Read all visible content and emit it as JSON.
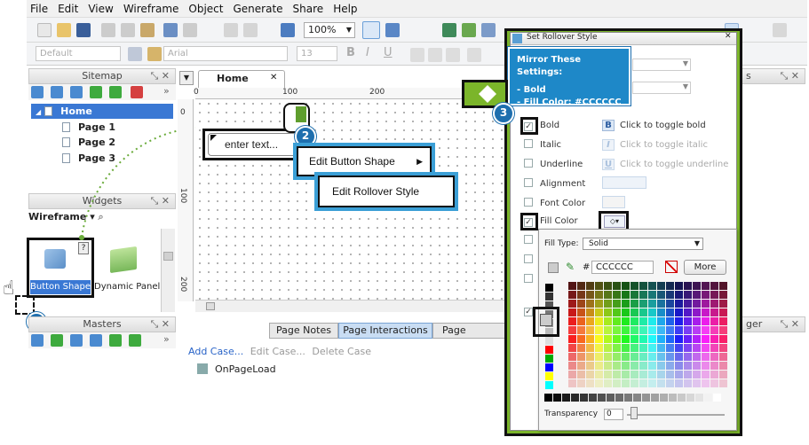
{
  "menubar": [
    "File",
    "Edit",
    "View",
    "Wireframe",
    "Object",
    "Generate",
    "Share",
    "Help"
  ],
  "toolbar": {
    "zoom": "100%",
    "style": "Default",
    "font": "Arial",
    "font_size": "13"
  },
  "sitemap": {
    "title": "Sitemap",
    "home": "Home",
    "pages": [
      "Page 1",
      "Page 2",
      "Page 3"
    ]
  },
  "widgets": {
    "title": "Widgets",
    "library": "Wireframe",
    "items": [
      "Button Shape",
      "Dynamic Panel"
    ]
  },
  "masters": {
    "title": "Masters"
  },
  "canvas": {
    "tab": "Home",
    "ruler_h": [
      "0",
      "100",
      "200"
    ],
    "ruler_v": [
      "100",
      "200"
    ],
    "widget_text": "enter text..."
  },
  "context_menu": {
    "item1": "Edit Button Shape",
    "item2": "Edit Rollover Style"
  },
  "bottom_tabs": [
    "Page Notes",
    "Page Interactions",
    "Page Formattin"
  ],
  "interactions": {
    "add_case": "Add Case...",
    "edit_case": "Edit Case...",
    "delete_case": "Delete Case",
    "event": "OnPageLoad"
  },
  "dialog": {
    "title": "Set Rollover Style",
    "callout_title": "Mirror These Settings:",
    "callout_line1": "- Bold",
    "callout_line2": "- Fill Color: #CCCCCC",
    "rows": [
      "Bold",
      "Italic",
      "Underline",
      "Alignment",
      "Font Color",
      "Fill Color"
    ],
    "hints": [
      "Click to toggle bold",
      "Click to toggle italic",
      "Click to toggle underline"
    ],
    "bold_icon": "B",
    "italic_icon": "I",
    "underline_icon": "U"
  },
  "color_picker": {
    "fill_type_label": "Fill Type:",
    "fill_type": "Solid",
    "hash": "#",
    "hex": "CCCCCC",
    "more": "More",
    "transparency_label": "Transparency",
    "transparency": "0"
  },
  "right_panel": {
    "partial1": "s",
    "partial2": "ger"
  },
  "steps": [
    "1",
    "2",
    "3"
  ],
  "colors": {
    "accent_green": "#7bb52a",
    "accent_blue": "#3b9fd6",
    "callout": "#1e88c8",
    "step": "#1e6fae"
  }
}
